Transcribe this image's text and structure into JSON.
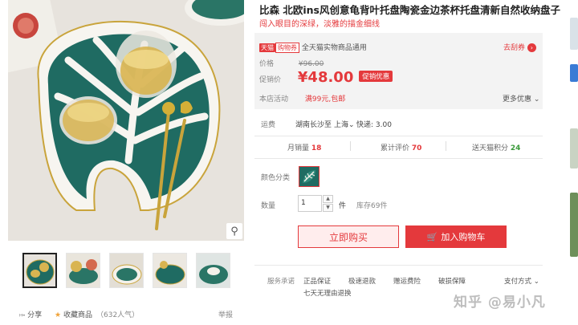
{
  "product": {
    "title": "比森 北欧ins风创意龟背叶托盘陶瓷金边茶杯托盘清新自然收纳盘子",
    "subtitle": "闯入眼目的深绿，淡雅的描金细线"
  },
  "price_panel": {
    "tmall_tag": "天猫",
    "pay_tag": "购物券",
    "coupon_text": "全天猫实物商品通用",
    "coupon_link": "去刮券",
    "price_label": "价格",
    "original_price": "¥96.00",
    "promo_label": "促销价",
    "promo_price": "¥48.00",
    "promo_badge": "促销优惠",
    "activity_label": "本店活动",
    "activity_text": "满99元,包邮",
    "more_offers": "更多优惠"
  },
  "shipping": {
    "label": "运费",
    "from": "湖南长沙",
    "to_prefix": "至",
    "to": "上海",
    "express": "快递: 3.00"
  },
  "stats": {
    "monthly_sales_label": "月销量",
    "monthly_sales": "18",
    "reviews_label": "累计评价",
    "reviews": "70",
    "points_label": "送天猫积分",
    "points": "24"
  },
  "color": {
    "label": "颜色分类"
  },
  "quantity": {
    "label": "数量",
    "value": "1",
    "unit": "件",
    "stock": "库存69件"
  },
  "buttons": {
    "buy_now": "立即购买",
    "add_to_cart": "加入购物车"
  },
  "services": {
    "label": "服务承诺",
    "items": [
      "正品保证",
      "极速退款",
      "赠运费险",
      "破损保障",
      "七天无理由退换"
    ],
    "payment": "支付方式"
  },
  "gallery": {
    "share": "分享",
    "favorite": "收藏商品",
    "popularity": "（632人气）",
    "report": "举报"
  },
  "watermark": "知乎 @易小凡",
  "colors": {
    "accent": "#e4393c",
    "green": "#1f6b62",
    "gold": "#c9a43b"
  }
}
